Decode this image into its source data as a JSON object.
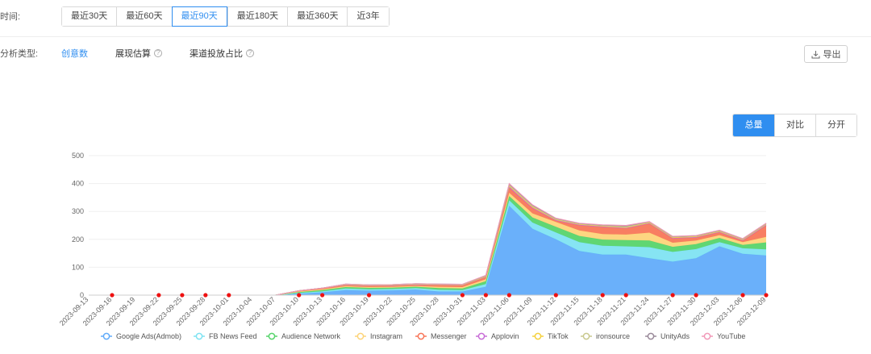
{
  "filters": {
    "time_label": "时间:",
    "time_options": [
      "最近30天",
      "最近60天",
      "最近90天",
      "最近180天",
      "最近360天",
      "近3年"
    ],
    "time_selected": "最近90天",
    "type_label": "分析类型:",
    "type_options": [
      "创意数",
      "展现估算",
      "渠道投放占比"
    ],
    "type_selected": "创意数",
    "export_label": "导出"
  },
  "view_toggle": {
    "options": [
      "总量",
      "对比",
      "分开"
    ],
    "selected": "总量"
  },
  "colors": {
    "accent": "#2f8ef0",
    "marker": "#ee1111"
  },
  "chart_data": {
    "type": "area",
    "stacked": true,
    "title": "",
    "xlabel": "",
    "ylabel": "",
    "ylim": [
      0,
      500
    ],
    "yticks": [
      0,
      100,
      200,
      300,
      400,
      500
    ],
    "grid": true,
    "legend_position": "bottom",
    "x": [
      "2023-09-13",
      "2023-09-16",
      "2023-09-19",
      "2023-09-22",
      "2023-09-25",
      "2023-09-28",
      "2023-10-01",
      "2023-10-04",
      "2023-10-07",
      "2023-10-10",
      "2023-10-13",
      "2023-10-16",
      "2023-10-19",
      "2023-10-22",
      "2023-10-25",
      "2023-10-28",
      "2023-10-31",
      "2023-11-03",
      "2023-11-06",
      "2023-11-09",
      "2023-11-12",
      "2023-11-15",
      "2023-11-18",
      "2023-11-21",
      "2023-11-24",
      "2023-11-27",
      "2023-11-30",
      "2023-12-03",
      "2023-12-06",
      "2023-12-09"
    ],
    "marked_dates": [
      "2023-09-16",
      "2023-09-22",
      "2023-09-25",
      "2023-09-28",
      "2023-10-01",
      "2023-10-10",
      "2023-10-13",
      "2023-10-19",
      "2023-10-31",
      "2023-11-03",
      "2023-11-06",
      "2023-11-12",
      "2023-11-18",
      "2023-11-21",
      "2023-11-27",
      "2023-11-30",
      "2023-12-06",
      "2023-12-09"
    ],
    "series": [
      {
        "name": "Google Ads(Admob)",
        "color": "#62acfa",
        "values": [
          0,
          0,
          0,
          0,
          0,
          0,
          0,
          0,
          0,
          5,
          10,
          18,
          16,
          17,
          20,
          13,
          13,
          30,
          320,
          238,
          200,
          158,
          145,
          145,
          132,
          120,
          132,
          175,
          148,
          142
        ]
      },
      {
        "name": "FB News Feed",
        "color": "#7fe3f2",
        "values": [
          0,
          0,
          0,
          0,
          0,
          0,
          0,
          0,
          0,
          3,
          4,
          6,
          5,
          5,
          5,
          6,
          5,
          10,
          20,
          22,
          25,
          32,
          32,
          30,
          40,
          35,
          33,
          15,
          20,
          22
        ]
      },
      {
        "name": "Audience Network",
        "color": "#57d46c",
        "values": [
          0,
          0,
          0,
          0,
          0,
          0,
          0,
          0,
          0,
          3,
          4,
          5,
          5,
          5,
          5,
          6,
          6,
          10,
          15,
          18,
          20,
          22,
          22,
          22,
          24,
          18,
          18,
          15,
          12,
          25
        ]
      },
      {
        "name": "Instagram",
        "color": "#fdd47a",
        "values": [
          0,
          0,
          0,
          0,
          0,
          0,
          0,
          0,
          0,
          2,
          3,
          3,
          3,
          3,
          3,
          5,
          5,
          7,
          12,
          15,
          17,
          20,
          20,
          20,
          28,
          15,
          13,
          10,
          10,
          20
        ]
      },
      {
        "name": "Messenger",
        "color": "#f8775a",
        "values": [
          0,
          0,
          0,
          0,
          0,
          0,
          0,
          0,
          0,
          3,
          4,
          4,
          4,
          4,
          4,
          6,
          6,
          8,
          18,
          18,
          5,
          18,
          25,
          22,
          32,
          15,
          10,
          10,
          5,
          40
        ]
      },
      {
        "name": "Applovin",
        "color": "#c86dd7",
        "values": [
          0,
          0,
          0,
          0,
          0,
          0,
          0,
          0,
          0,
          0,
          0,
          1,
          1,
          1,
          1,
          1,
          1,
          1,
          4,
          3,
          2,
          2,
          2,
          2,
          2,
          2,
          2,
          2,
          2,
          3
        ]
      },
      {
        "name": "TikTok",
        "color": "#f5d13e",
        "values": [
          0,
          0,
          0,
          0,
          0,
          0,
          0,
          0,
          0,
          0,
          0,
          1,
          1,
          1,
          1,
          1,
          1,
          1,
          3,
          3,
          2,
          2,
          2,
          2,
          2,
          2,
          2,
          2,
          2,
          2
        ]
      },
      {
        "name": "ironsource",
        "color": "#c9c98f",
        "values": [
          0,
          0,
          0,
          0,
          0,
          0,
          0,
          0,
          0,
          0,
          0,
          1,
          1,
          1,
          1,
          1,
          1,
          2,
          4,
          3,
          2,
          2,
          2,
          3,
          2,
          2,
          2,
          2,
          2,
          2
        ]
      },
      {
        "name": "UnityAds",
        "color": "#9a8a9a",
        "values": [
          0,
          0,
          0,
          0,
          0,
          0,
          0,
          0,
          0,
          0,
          0,
          1,
          1,
          1,
          1,
          1,
          1,
          1,
          2,
          2,
          2,
          1,
          1,
          2,
          1,
          1,
          1,
          1,
          1,
          1
        ]
      },
      {
        "name": "YouTube",
        "color": "#f29ab9",
        "values": [
          0,
          0,
          0,
          0,
          0,
          0,
          0,
          0,
          0,
          0,
          0,
          0,
          0,
          0,
          0,
          0,
          0,
          1,
          2,
          2,
          1,
          1,
          1,
          2,
          1,
          1,
          1,
          1,
          1,
          1
        ]
      }
    ]
  }
}
